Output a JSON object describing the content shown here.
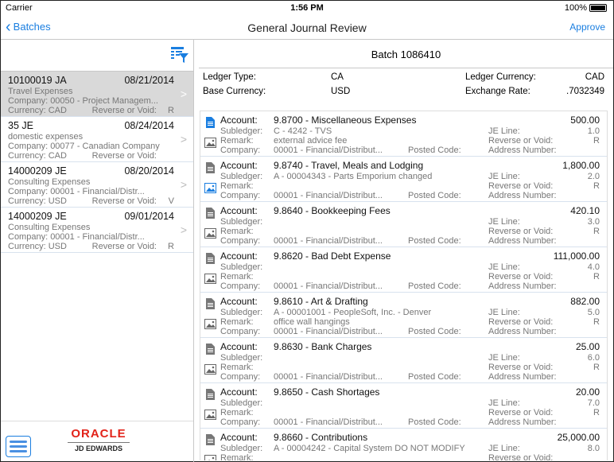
{
  "status": {
    "carrier": "Carrier",
    "time": "1:56 PM",
    "battery": "100%"
  },
  "nav": {
    "back": "Batches",
    "title": "General Journal Review",
    "approve": "Approve"
  },
  "batches": [
    {
      "doc": "10100019 JA",
      "date": "08/21/2014",
      "desc": "Travel Expenses",
      "company": "Company: 00050 - Project Managem...",
      "currency": "Currency: CAD",
      "rv_label": "Reverse or Void:",
      "rv": "R",
      "selected": true
    },
    {
      "doc": "35 JE",
      "date": "08/24/2014",
      "desc": "domestic expenses",
      "company": "Company: 00077 - Canadian Company",
      "currency": "Currency: CAD",
      "rv_label": "Reverse or Void:",
      "rv": ""
    },
    {
      "doc": "14000209 JE",
      "date": "08/20/2014",
      "desc": "Consulting Expenses",
      "company": "Company: 00001 - Financial/Distr...",
      "currency": "Currency: USD",
      "rv_label": "Reverse or Void:",
      "rv": "V"
    },
    {
      "doc": "14000209 JE",
      "date": "09/01/2014",
      "desc": "Consulting Expenses",
      "company": "Company: 00001 - Financial/Distr...",
      "currency": "Currency: USD",
      "rv_label": "Reverse or Void:",
      "rv": "R"
    }
  ],
  "logo": {
    "oracle": "ORACLE",
    "jde": "JD EDWARDS"
  },
  "batch": {
    "title": "Batch 1086410",
    "ledger_type_label": "Ledger Type:",
    "ledger_type": "CA",
    "base_currency_label": "Base Currency:",
    "base_currency": "USD",
    "ledger_currency_label": "Ledger Currency:",
    "ledger_currency": "CAD",
    "exchange_rate_label": "Exchange Rate:",
    "exchange_rate": ".7032349"
  },
  "labels": {
    "account": "Account:",
    "subledger": "Subledger:",
    "remark": "Remark:",
    "company": "Company:",
    "posted_code": "Posted Code:",
    "je_line": "JE Line:",
    "reverse": "Reverse or Void:",
    "address": "Address Number:"
  },
  "lines": [
    {
      "account": "9.8700 - Miscellaneous Expenses",
      "amount": "500.00",
      "subledger": "C - 4242 - TVS",
      "remark": "external advice fee",
      "company": "00001 - Financial/Distribut...",
      "je_line": "1.0",
      "rv": "R",
      "doc_blue": true,
      "img_blue": false
    },
    {
      "account": "9.8740 - Travel, Meals and Lodging",
      "amount": "1,800.00",
      "subledger": "A - 00004343 - Parts Emporium changed",
      "remark": "",
      "company": "00001 - Financial/Distribut...",
      "je_line": "2.0",
      "rv": "R",
      "doc_blue": false,
      "img_blue": true
    },
    {
      "account": "9.8640 - Bookkeeping Fees",
      "amount": "420.10",
      "subledger": "",
      "remark": "",
      "company": "00001 - Financial/Distribut...",
      "je_line": "3.0",
      "rv": "R"
    },
    {
      "account": "9.8620 - Bad Debt Expense",
      "amount": "111,000.00",
      "subledger": "",
      "remark": "",
      "company": "00001 - Financial/Distribut...",
      "je_line": "4.0",
      "rv": "R"
    },
    {
      "account": "9.8610 - Art & Drafting",
      "amount": "882.00",
      "subledger": "A - 00001001 - PeopleSoft, Inc. - Denver",
      "remark": "office wall hangings",
      "company": "00001 - Financial/Distribut...",
      "je_line": "5.0",
      "rv": "R"
    },
    {
      "account": "9.8630 - Bank Charges",
      "amount": "25.00",
      "subledger": "",
      "remark": "",
      "company": "00001 - Financial/Distribut...",
      "je_line": "6.0",
      "rv": "R"
    },
    {
      "account": "9.8650 - Cash Shortages",
      "amount": "20.00",
      "subledger": "",
      "remark": "",
      "company": "00001 - Financial/Distribut...",
      "je_line": "7.0",
      "rv": "R"
    },
    {
      "account": "9.8660 - Contributions",
      "amount": "25,000.00",
      "subledger": "A - 00004242 - Capital System DO NOT MODIFY",
      "remark": "",
      "company": "",
      "je_line": "8.0",
      "rv": ""
    }
  ],
  "colors": {
    "accent": "#1a7ee0",
    "oracle_red": "#e2231a",
    "selected_bg": "#d9d9d9"
  }
}
